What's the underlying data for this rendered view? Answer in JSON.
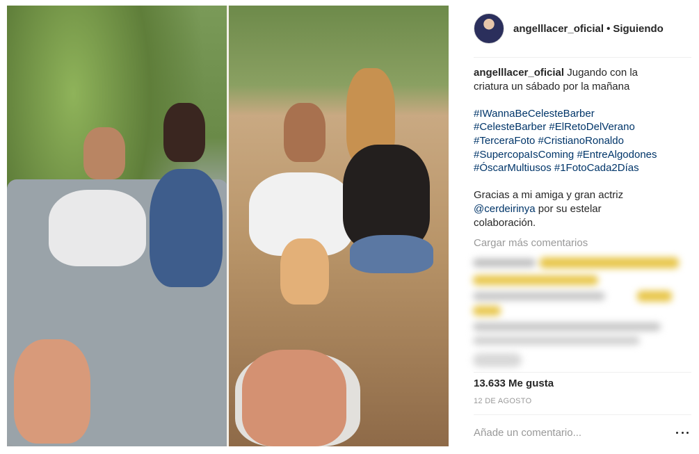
{
  "post": {
    "photo_alt": "Foto comparativa",
    "username": "angelllacer_oficial",
    "follow_status": "Siguiendo",
    "separator": "•",
    "caption": {
      "text_line1": "Jugando con la",
      "text_line2": "criatura un sábado por la mañana",
      "hashtags": [
        [
          "#IWannaBeCelesteBarber"
        ],
        [
          "#CelesteBarber",
          "#ElRetoDelVerano"
        ],
        [
          "#TerceraFoto",
          "#CristianoRonaldo"
        ],
        [
          "#SupercopaIsComing",
          "#EntreAlgodones"
        ],
        [
          "#ÓscarMultiusos",
          "#1FotoCada2Días"
        ]
      ],
      "thanks_line1": "Gracias a mi amiga y gran actriz",
      "mention": "@cerdeirinya",
      "thanks_line2_rest": " por su estelar",
      "thanks_line3": "colaboración."
    },
    "load_more": "Cargar más comentarios",
    "likes": "13.633 Me gusta",
    "date": "12 DE AGOSTO",
    "comment_placeholder": "Añade un comentario...",
    "colors": {
      "text": "#262626",
      "link": "#003569",
      "muted": "#999999"
    }
  }
}
